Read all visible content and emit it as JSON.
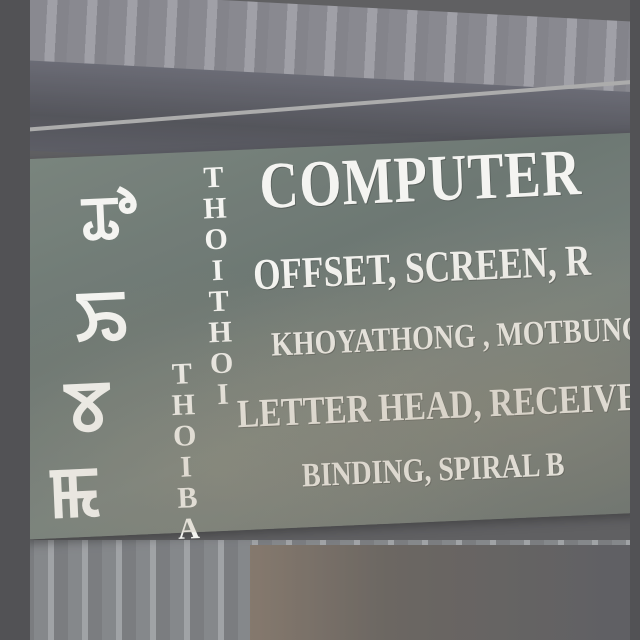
{
  "sign": {
    "title": "COMPUTER",
    "line1": "OFFSET, SCREEN, R",
    "line2": "KHOYATHONG , MOTBUNG",
    "line3": "LETTER HEAD, RECEIVED, IN",
    "line4": "BINDING, SPIRAL B",
    "vertical_1": "THOITHOI",
    "vertical_2": "THOIBA",
    "script_glyphs": [
      "ꯊꯣ",
      "ꯢ",
      "ꯕ",
      "ꯃ"
    ]
  },
  "colors": {
    "board": "#56635c",
    "lettering": "#f2f2ee",
    "roof": "#7a7a83"
  }
}
